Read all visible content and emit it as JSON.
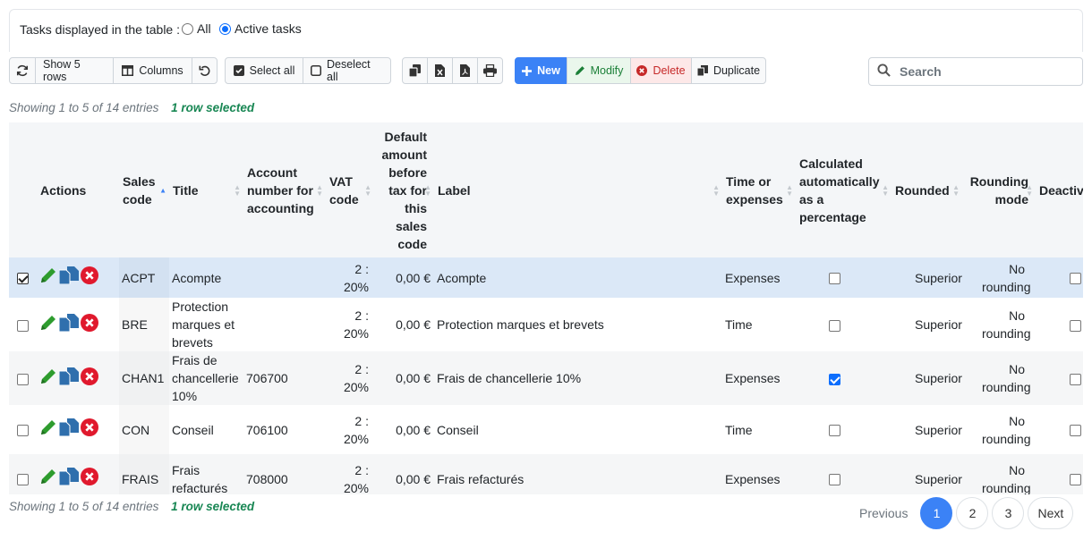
{
  "filter": {
    "label": "Tasks displayed in the table :",
    "options": [
      {
        "label": "All",
        "checked": false
      },
      {
        "label": "Active tasks",
        "checked": true
      }
    ]
  },
  "toolbar": {
    "refresh_icon": "refresh-icon",
    "show_rows": "Show 5 rows",
    "columns": "Columns",
    "reset_icon": "undo-icon",
    "select_all": "Select all",
    "deselect_all": "Deselect all",
    "copy_icon": "copy-icon",
    "excel_icon": "excel-icon",
    "pdf_icon": "pdf-icon",
    "print_icon": "print-icon",
    "new": "New",
    "modify": "Modify",
    "delete": "Delete",
    "duplicate": "Duplicate"
  },
  "search": {
    "placeholder": "Search",
    "value": ""
  },
  "info": {
    "top_text": "Showing 1 to 5 of 14 entries",
    "top_selected": "1 row selected",
    "bottom_text": "Showing 1 to 5 of 14 entries",
    "bottom_selected": "1 row selected"
  },
  "table": {
    "headers": {
      "actions": "Actions",
      "sales_code": "Sales code",
      "title": "Title",
      "account": "Account number for accounting",
      "vat": "VAT code",
      "amount": "Default amount before tax for this sales code",
      "label": "Label",
      "time_or_expenses": "Time or expenses",
      "calculated": "Calculated automatically as a percentage",
      "rounded": "Rounded",
      "rounding_mode": "Rounding mode",
      "deactivated": "Deactivated"
    },
    "rows": [
      {
        "selected": true,
        "code": "ACPT",
        "title": "Acompte",
        "account": "",
        "vat": "2 : 20%",
        "amount": "0,00 €",
        "label": "Acompte",
        "type": "Expenses",
        "calculated": false,
        "rounded": "Superior",
        "rounding_mode": "No rounding"
      },
      {
        "selected": false,
        "code": "BRE",
        "title": "Protection marques et brevets",
        "account": "",
        "vat": "2 : 20%",
        "amount": "0,00 €",
        "label": "Protection marques et brevets",
        "type": "Time",
        "calculated": false,
        "rounded": "Superior",
        "rounding_mode": "No rounding"
      },
      {
        "selected": false,
        "code": "CHAN1",
        "title": "Frais de chancellerie 10%",
        "account": "706700",
        "vat": "2 : 20%",
        "amount": "0,00 €",
        "label": "Frais de chancellerie 10%",
        "type": "Expenses",
        "calculated": true,
        "rounded": "Superior",
        "rounding_mode": "No rounding"
      },
      {
        "selected": false,
        "code": "CON",
        "title": "Conseil",
        "account": "706100",
        "vat": "2 : 20%",
        "amount": "0,00 €",
        "label": "Conseil",
        "type": "Time",
        "calculated": false,
        "rounded": "Superior",
        "rounding_mode": "No rounding"
      },
      {
        "selected": false,
        "code": "FRAIS",
        "title": "Frais refacturés",
        "account": "708000",
        "vat": "2 : 20%",
        "amount": "0,00 €",
        "label": "Frais refacturés",
        "type": "Expenses",
        "calculated": false,
        "rounded": "Superior",
        "rounding_mode": "No rounding"
      }
    ]
  },
  "pagination": {
    "previous": "Previous",
    "pages": [
      "1",
      "2",
      "3"
    ],
    "current": "1",
    "next": "Next"
  },
  "colors": {
    "accent": "#3b82f6",
    "selected_row": "#dbe8f7",
    "green": "#1a7f37",
    "red": "#e0192d",
    "edit_green": "#2e9c2e",
    "doc_blue": "#2f6fad"
  }
}
